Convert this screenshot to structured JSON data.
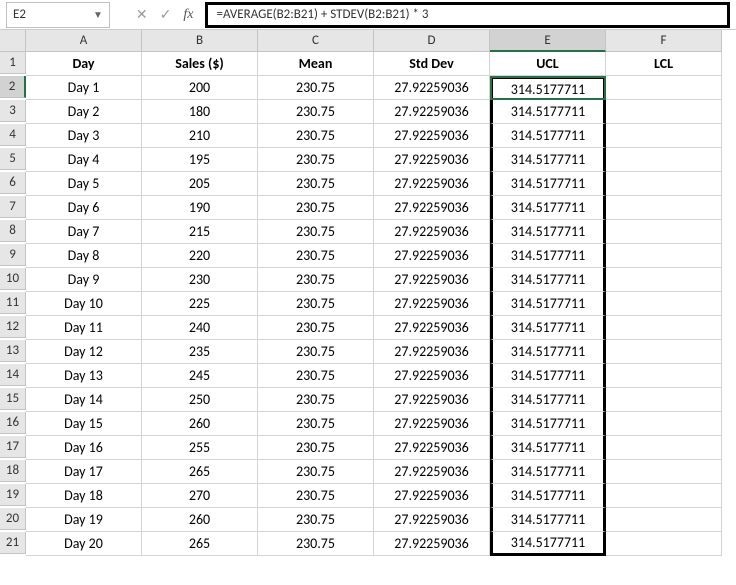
{
  "namebox": "E2",
  "formula": "=AVERAGE(B2:B21) + STDEV(B2:B21) * 3",
  "columns": [
    "A",
    "B",
    "C",
    "D",
    "E",
    "F"
  ],
  "headers": [
    "Day",
    "Sales ($)",
    "Mean",
    "Std Dev",
    "UCL",
    "LCL"
  ],
  "rows": [
    {
      "n": 1
    },
    {
      "n": 2,
      "day": "Day 1",
      "sales": "200",
      "mean": "230.75",
      "sd": "27.92259036",
      "ucl": "314.5177711",
      "lcl": ""
    },
    {
      "n": 3,
      "day": "Day 2",
      "sales": "180",
      "mean": "230.75",
      "sd": "27.92259036",
      "ucl": "314.5177711",
      "lcl": ""
    },
    {
      "n": 4,
      "day": "Day 3",
      "sales": "210",
      "mean": "230.75",
      "sd": "27.92259036",
      "ucl": "314.5177711",
      "lcl": ""
    },
    {
      "n": 5,
      "day": "Day 4",
      "sales": "195",
      "mean": "230.75",
      "sd": "27.92259036",
      "ucl": "314.5177711",
      "lcl": ""
    },
    {
      "n": 6,
      "day": "Day 5",
      "sales": "205",
      "mean": "230.75",
      "sd": "27.92259036",
      "ucl": "314.5177711",
      "lcl": ""
    },
    {
      "n": 7,
      "day": "Day 6",
      "sales": "190",
      "mean": "230.75",
      "sd": "27.92259036",
      "ucl": "314.5177711",
      "lcl": ""
    },
    {
      "n": 8,
      "day": "Day 7",
      "sales": "215",
      "mean": "230.75",
      "sd": "27.92259036",
      "ucl": "314.5177711",
      "lcl": ""
    },
    {
      "n": 9,
      "day": "Day 8",
      "sales": "220",
      "mean": "230.75",
      "sd": "27.92259036",
      "ucl": "314.5177711",
      "lcl": ""
    },
    {
      "n": 10,
      "day": "Day 9",
      "sales": "230",
      "mean": "230.75",
      "sd": "27.92259036",
      "ucl": "314.5177711",
      "lcl": ""
    },
    {
      "n": 11,
      "day": "Day 10",
      "sales": "225",
      "mean": "230.75",
      "sd": "27.92259036",
      "ucl": "314.5177711",
      "lcl": ""
    },
    {
      "n": 12,
      "day": "Day 11",
      "sales": "240",
      "mean": "230.75",
      "sd": "27.92259036",
      "ucl": "314.5177711",
      "lcl": ""
    },
    {
      "n": 13,
      "day": "Day 12",
      "sales": "235",
      "mean": "230.75",
      "sd": "27.92259036",
      "ucl": "314.5177711",
      "lcl": ""
    },
    {
      "n": 14,
      "day": "Day 13",
      "sales": "245",
      "mean": "230.75",
      "sd": "27.92259036",
      "ucl": "314.5177711",
      "lcl": ""
    },
    {
      "n": 15,
      "day": "Day 14",
      "sales": "250",
      "mean": "230.75",
      "sd": "27.92259036",
      "ucl": "314.5177711",
      "lcl": ""
    },
    {
      "n": 16,
      "day": "Day 15",
      "sales": "260",
      "mean": "230.75",
      "sd": "27.92259036",
      "ucl": "314.5177711",
      "lcl": ""
    },
    {
      "n": 17,
      "day": "Day 16",
      "sales": "255",
      "mean": "230.75",
      "sd": "27.92259036",
      "ucl": "314.5177711",
      "lcl": ""
    },
    {
      "n": 18,
      "day": "Day 17",
      "sales": "265",
      "mean": "230.75",
      "sd": "27.92259036",
      "ucl": "314.5177711",
      "lcl": ""
    },
    {
      "n": 19,
      "day": "Day 18",
      "sales": "270",
      "mean": "230.75",
      "sd": "27.92259036",
      "ucl": "314.5177711",
      "lcl": ""
    },
    {
      "n": 20,
      "day": "Day 19",
      "sales": "260",
      "mean": "230.75",
      "sd": "27.92259036",
      "ucl": "314.5177711",
      "lcl": ""
    },
    {
      "n": 21,
      "day": "Day 20",
      "sales": "265",
      "mean": "230.75",
      "sd": "27.92259036",
      "ucl": "314.5177711",
      "lcl": ""
    }
  ]
}
